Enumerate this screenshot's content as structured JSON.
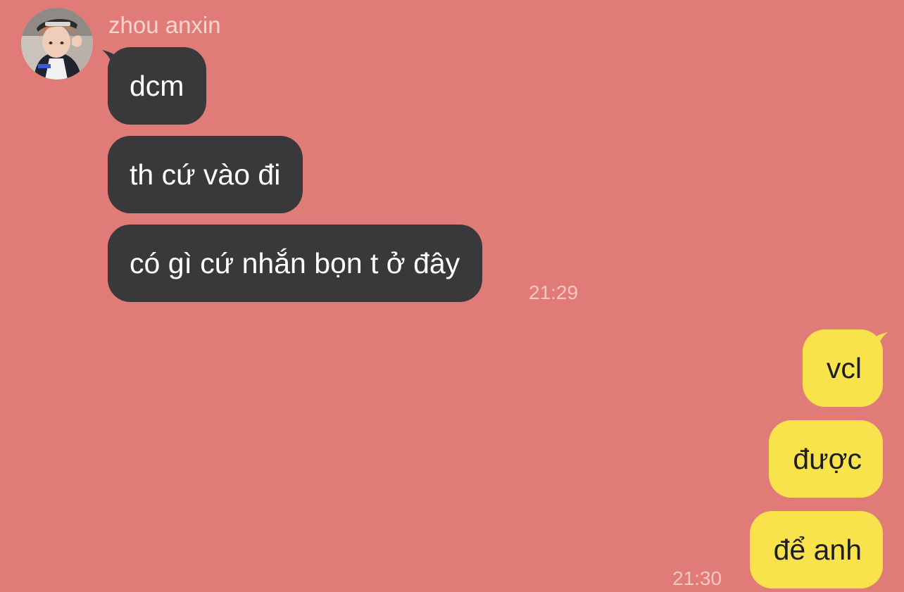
{
  "conversation": {
    "contact_name": "zhou anxin",
    "avatar_icon": "profile-photo",
    "incoming": {
      "bubble_color": "#39393b",
      "messages": [
        {
          "text": "dcm"
        },
        {
          "text": "th cứ vào đi"
        },
        {
          "text": "có gì cứ nhắn bọn t ở đây"
        }
      ],
      "time": "21:29"
    },
    "outgoing": {
      "bubble_color": "#f8e34c",
      "messages": [
        {
          "text": "vcl"
        },
        {
          "text": "được"
        },
        {
          "text": "để anh"
        }
      ],
      "time": "21:30"
    },
    "background_color": "#e17b78"
  }
}
